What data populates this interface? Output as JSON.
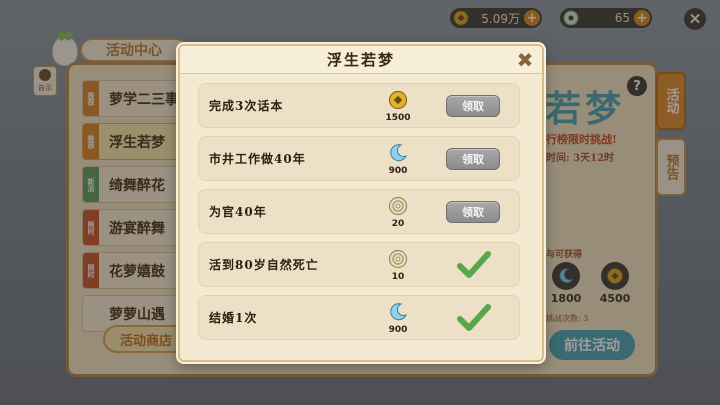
{
  "currency": {
    "coins": "5.09万",
    "jade": "65"
  },
  "background": {
    "center_tab_title": "活动中心",
    "notice_label": "告示",
    "activities": [
      {
        "tag": "推荐",
        "tag_color": "#d9832a",
        "name": "萝学二三事"
      },
      {
        "tag": "推荐",
        "tag_color": "#d9832a",
        "name": "浮生若梦"
      },
      {
        "tag": "新活",
        "tag_color": "#5b9d5b",
        "name": "绮舞醉花"
      },
      {
        "tag": "限时",
        "tag_color": "#c9552a",
        "name": "游宴醉舞"
      },
      {
        "tag": "限时",
        "tag_color": "#c9552a",
        "name": "花萝嬉鼓"
      },
      {
        "tag": "",
        "tag_color": "#c9a76a",
        "name": "萝萝山遇"
      }
    ],
    "shop_button": "活动商店",
    "big_title": "若梦",
    "subtitle": "行榜限时挑战!",
    "time_left": "时间: 3天12时",
    "reward_hint": "与可获得",
    "rewards": [
      "1800",
      "4500"
    ],
    "challenge_hint": "挑战次数: 3",
    "goto_button": "前往活动",
    "side_tabs": [
      "活动",
      "预告"
    ]
  },
  "modal": {
    "title": "浮生若梦",
    "tasks": [
      {
        "name": "完成3次话本",
        "reward_icon": "coin-icon",
        "reward": "1500",
        "status": "claim",
        "claim_label": "领取"
      },
      {
        "name": "市井工作做40年",
        "reward_icon": "moon-gem-icon",
        "reward": "900",
        "status": "claim",
        "claim_label": "领取"
      },
      {
        "name": "为官40年",
        "reward_icon": "jade-disc-icon",
        "reward": "20",
        "status": "claim",
        "claim_label": "领取"
      },
      {
        "name": "活到80岁自然死亡",
        "reward_icon": "jade-disc-icon",
        "reward": "10",
        "status": "done"
      },
      {
        "name": "结婚1次",
        "reward_icon": "moon-gem-icon",
        "reward": "900",
        "status": "done"
      }
    ]
  }
}
